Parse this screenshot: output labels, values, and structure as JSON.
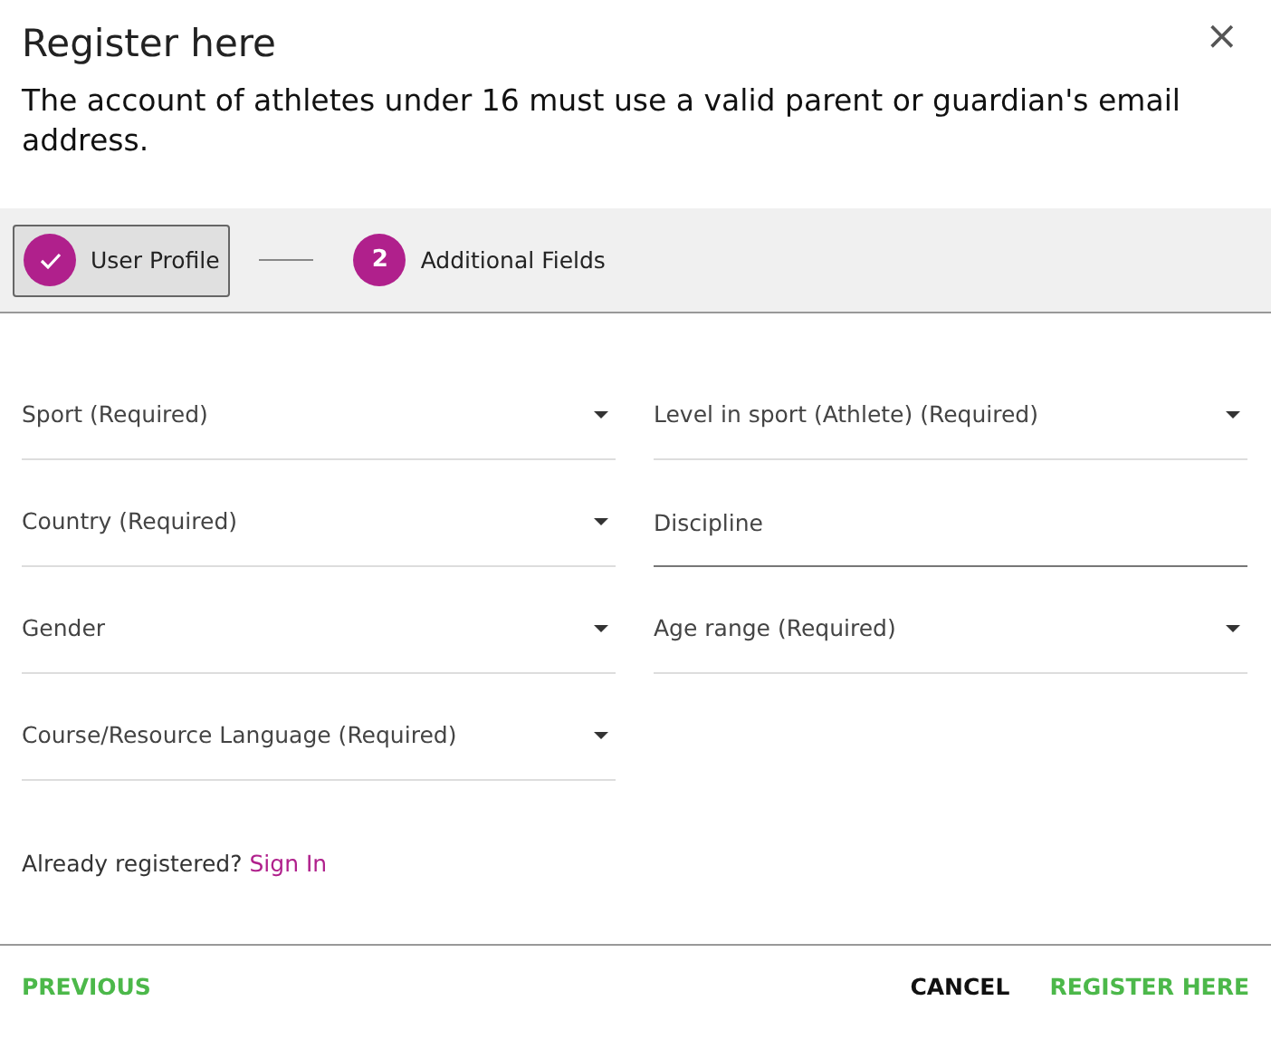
{
  "dialog": {
    "title": "Register here",
    "close_icon": "×",
    "message": "The account of athletes under 16 must use a valid parent or guardian's email address."
  },
  "steps": [
    {
      "label": "User Profile",
      "completed": true,
      "selected": true
    },
    {
      "label": "Additional Fields",
      "number": "2",
      "completed": false,
      "selected": false
    }
  ],
  "fields": [
    {
      "kind": "dropdown",
      "placeholder": "Sport (Required)"
    },
    {
      "kind": "dropdown",
      "placeholder": "Level in sport (Athlete) (Required)"
    },
    {
      "kind": "dropdown",
      "placeholder": "Country (Required)"
    },
    {
      "kind": "text",
      "placeholder": "Discipline"
    },
    {
      "kind": "dropdown",
      "placeholder": "Gender"
    },
    {
      "kind": "dropdown",
      "placeholder": "Age range (Required)"
    },
    {
      "kind": "dropdown",
      "placeholder": "Course/Resource Language (Required)"
    }
  ],
  "sign_in": {
    "prompt": "Already registered?",
    "link": "Sign In"
  },
  "footer": {
    "previous": "PREVIOUS",
    "cancel": "CANCEL",
    "register": "REGISTER HERE"
  }
}
